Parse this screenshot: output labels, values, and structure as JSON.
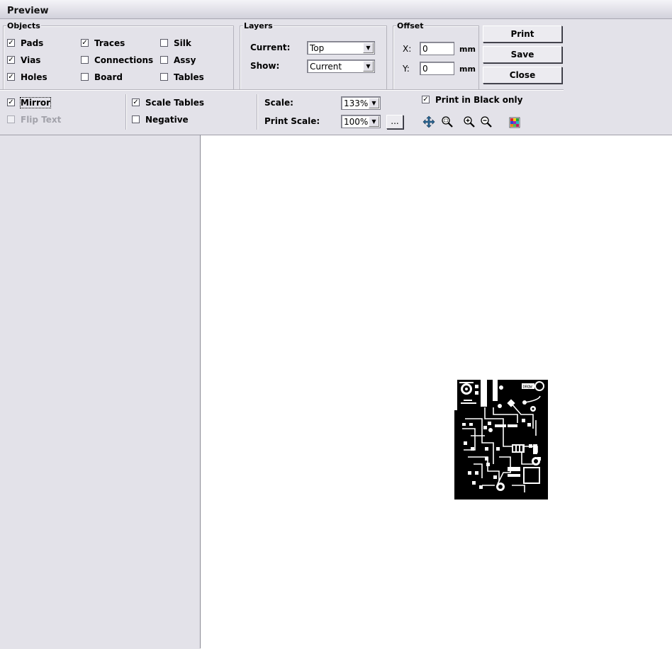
{
  "window": {
    "title": "Preview"
  },
  "objects": {
    "legend": "Objects",
    "items": [
      {
        "label": "Pads",
        "checked": true
      },
      {
        "label": "Traces",
        "checked": true
      },
      {
        "label": "Silk",
        "checked": false
      },
      {
        "label": "Vias",
        "checked": true
      },
      {
        "label": "Connections",
        "checked": false
      },
      {
        "label": "Assy",
        "checked": false
      },
      {
        "label": "Holes",
        "checked": true
      },
      {
        "label": "Board",
        "checked": false
      },
      {
        "label": "Tables",
        "checked": false
      }
    ]
  },
  "layers": {
    "legend": "Layers",
    "current_label": "Current:",
    "current_value": "Top",
    "show_label": "Show:",
    "show_value": "Current"
  },
  "offset": {
    "legend": "Offset",
    "x_label": "X:",
    "x_value": "0",
    "y_label": "Y:",
    "y_value": "0",
    "unit": "mm"
  },
  "buttons": {
    "print": "Print",
    "save": "Save",
    "close": "Close",
    "ellipsis": "..."
  },
  "options": {
    "mirror": {
      "label": "Mirror",
      "checked": true
    },
    "flip_text": {
      "label": "Flip Text",
      "checked": false,
      "disabled": true
    },
    "scale_tables": {
      "label": "Scale Tables",
      "checked": true
    },
    "negative": {
      "label": "Negative",
      "checked": false
    },
    "print_black": {
      "label": "Print in Black only",
      "checked": true
    }
  },
  "scale": {
    "scale_label": "Scale:",
    "scale_value": "133%",
    "print_scale_label": "Print Scale:",
    "print_scale_value": "100%"
  },
  "pcb": {
    "silk_label": "DRQW"
  },
  "colors": {
    "pcb_copper": "#000000",
    "canvas": "#ffffff",
    "panel": "#e3e2e9"
  }
}
